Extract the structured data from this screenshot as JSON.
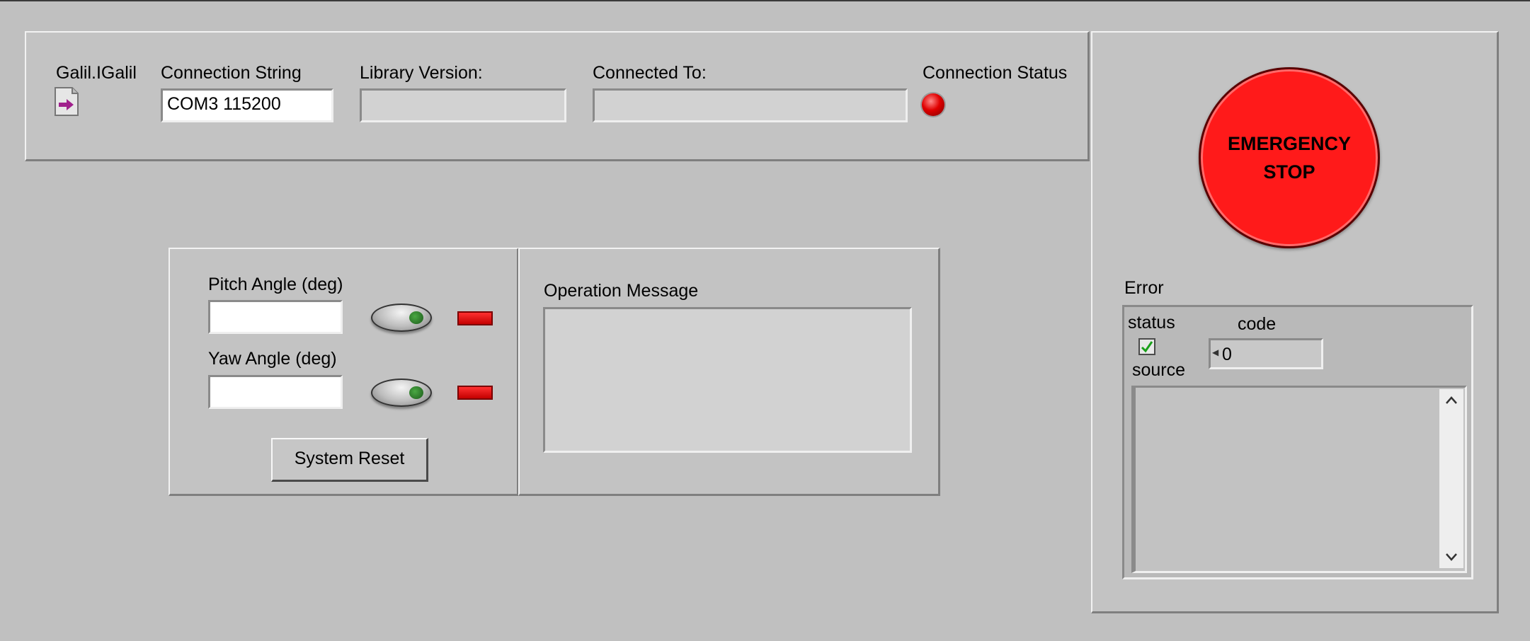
{
  "connection": {
    "galil_label": "Galil.IGalil",
    "galil_icon": "refnum-arrow-icon",
    "conn_string_label": "Connection String",
    "conn_string_value": "COM3 115200",
    "library_version_label": "Library Version:",
    "library_version_value": "",
    "connected_to_label": "Connected To:",
    "connected_to_value": "",
    "status_label": "Connection Status",
    "status_color": "#e00000"
  },
  "emergency": {
    "line1": "EMERGENCY",
    "line2": "STOP",
    "color": "#ff1a1a"
  },
  "controls": {
    "pitch_label": "Pitch Angle (deg)",
    "pitch_value": "",
    "yaw_label": "Yaw Angle (deg)",
    "yaw_value": "",
    "reset_label": "System Reset",
    "indicator_color": "#e00000"
  },
  "operation": {
    "label": "Operation Message",
    "value": ""
  },
  "error": {
    "label": "Error",
    "status_label": "status",
    "status_checked": true,
    "code_label": "code",
    "code_value": "0",
    "source_label": "source",
    "source_value": "",
    "scroll_up": "^",
    "scroll_down": "v"
  }
}
